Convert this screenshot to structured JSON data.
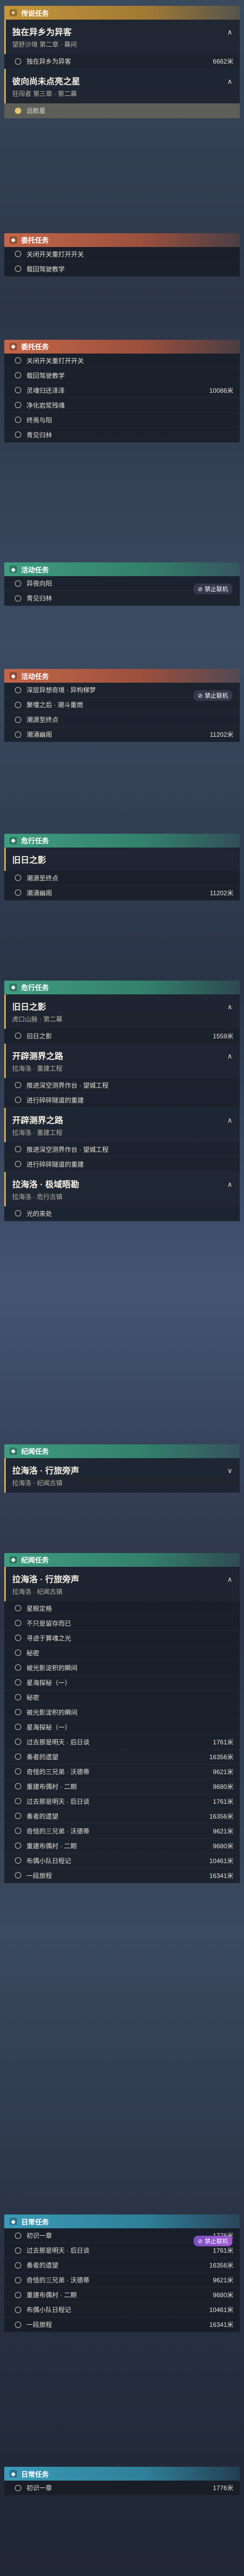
{
  "texts": {
    "legend_quest": "传说任务",
    "world_quest": "委托任务",
    "event_quest": "活动任务",
    "daily_quest": "日常任务",
    "danger_quest": "危行任务",
    "record_quest": "纪闻任务"
  },
  "badges": {
    "disable": "禁止联机",
    "stop": "禁止联机"
  },
  "sections": [
    {
      "type": "legend",
      "header": "传说任务",
      "cards": [
        {
          "title": "独在异乡为异客",
          "sub": "望舒沙境 第二章 · 幕间",
          "arrow": "∧",
          "steps": [
            {
              "t": "独在异乡为异客",
              "d": "6662米"
            }
          ]
        },
        {
          "title": "彼向尚未点亮之星",
          "sub": "狂闯者 第三章 · 第二幕",
          "arrow": "∧",
          "steps": [
            {
              "t": "远航星",
              "d": "",
              "active": true
            }
          ]
        }
      ]
    },
    {
      "type": "world",
      "header": "委托任务",
      "steps": [
        {
          "t": "关闭开关重打开开关",
          "d": ""
        },
        {
          "t": "载回驾驶教学",
          "d": ""
        }
      ]
    },
    {
      "type": "world",
      "header": "委托任务",
      "steps": [
        {
          "t": "关闭开关重打开开关",
          "d": ""
        },
        {
          "t": "载回驾驶教学",
          "d": ""
        },
        {
          "t": "灵魂归还泽泽",
          "d": "10086米"
        },
        {
          "t": "净化岩浆残魂",
          "d": ""
        },
        {
          "t": "终焉与阳",
          "d": ""
        },
        {
          "t": "青见归林",
          "d": ""
        }
      ]
    },
    {
      "type": "event",
      "header": "活动任务",
      "badge": "禁止联机",
      "steps": [
        {
          "t": "异夜向阳",
          "d": ""
        },
        {
          "t": "青见归林",
          "d": ""
        }
      ]
    },
    {
      "type": "world",
      "header": "活动任务",
      "badge": "禁止联机",
      "steps": [
        {
          "t": "深层异想奇境 · 异构梯梦",
          "d": ""
        },
        {
          "t": "聚嚏之后 · 潮斗重燃",
          "d": ""
        },
        {
          "t": "潮源至终点",
          "d": ""
        },
        {
          "t": "潮涌幽阁",
          "d": "11202米"
        }
      ]
    },
    {
      "type": "event",
      "header": "危行任务",
      "cards": [
        {
          "title": "旧日之影",
          "sub": "",
          "arrow": "",
          "steps": [
            {
              "t": "潮源至终点",
              "d": ""
            },
            {
              "t": "潮涌幽阁",
              "d": "11202米"
            }
          ]
        }
      ]
    },
    {
      "type": "event",
      "header": "危行任务",
      "cards": [
        {
          "title": "旧日之影",
          "sub": "虎口山脉 · 第二幕",
          "arrow": "∧",
          "steps": [
            {
              "t": "旧日之影",
              "d": "1559米"
            }
          ]
        },
        {
          "title": "开辟测界之路",
          "sub": "拉海洛 · 重建工程",
          "arrow": "∧",
          "steps": [
            {
              "t": "推进深空测界作台 · 望城工程",
              "d": ""
            },
            {
              "t": "进行碎碎隧道的重建",
              "d": ""
            }
          ]
        },
        {
          "title": "开辟测界之路",
          "sub": "拉海洛 · 重建工程",
          "arrow": "∧",
          "steps": [
            {
              "t": "推进深空测界作台 · 望城工程",
              "d": ""
            },
            {
              "t": "进行碎碎隧道的重建",
              "d": ""
            }
          ]
        },
        {
          "title": "拉海洛 · 极域晤勘",
          "sub": "拉海洛 · 危行古镇",
          "arrow": "∧",
          "steps": [
            {
              "t": "光的来处",
              "d": ""
            }
          ]
        }
      ]
    },
    {
      "type": "event",
      "header": "纪闻任务",
      "cards": [
        {
          "title": "拉海洛 · 行旅旁声",
          "sub": "拉海洛 · 纪闻古镇",
          "arrow": "∨",
          "steps": []
        }
      ]
    },
    {
      "type": "event",
      "header": "纪闻任务",
      "cards": [
        {
          "title": "拉海洛 · 行旅旁声",
          "sub": "拉海洛 · 纪闻古镇",
          "arrow": "∧",
          "steps": [
            {
              "t": "星眼定格",
              "d": ""
            },
            {
              "t": "不只是留存而已",
              "d": ""
            },
            {
              "t": "寻迹于算魂之光",
              "d": ""
            },
            {
              "t": "秘密",
              "d": ""
            },
            {
              "t": "被光影淀积的瞬间",
              "d": ""
            },
            {
              "t": "星海探秘（一）",
              "d": ""
            },
            {
              "t": "秘密",
              "d": ""
            },
            {
              "t": "被光影淀积的瞬间",
              "d": ""
            },
            {
              "t": "星海探秘（一）",
              "d": ""
            },
            {
              "t": "过去那是明天 · 后日谈",
              "d": "1761米"
            },
            {
              "t": "奏者的遗望",
              "d": "16356米"
            },
            {
              "t": "奇怪的三兄弟 · 沃德蒂",
              "d": "9621米"
            },
            {
              "t": "重建布偶村 · 二期",
              "d": "9680米"
            },
            {
              "t": "过去那是明天 · 后日谈",
              "d": "1761米"
            },
            {
              "t": "奏者的遗望",
              "d": "16356米"
            },
            {
              "t": "奇怪的三兄弟 · 沃德蒂",
              "d": "9621米"
            },
            {
              "t": "重建布偶村 · 二期",
              "d": "9680米"
            },
            {
              "t": "布偶小队日程记",
              "d": "10461米"
            },
            {
              "t": "一段旅程",
              "d": "16341米"
            }
          ]
        }
      ]
    },
    {
      "type": "daily",
      "header": "日常任务",
      "badge": "禁止联机",
      "steps": [
        {
          "t": "初识一章",
          "d": "1776米"
        },
        {
          "t": "过去那是明天 · 后日谈",
          "d": "1761米"
        },
        {
          "t": "奏者的遗望",
          "d": "16356米"
        },
        {
          "t": "奇怪的三兄弟 · 沃德蒂",
          "d": "9621米"
        },
        {
          "t": "重建布偶村 · 二期",
          "d": "9680米"
        },
        {
          "t": "布偶小队日程记",
          "d": "10461米"
        },
        {
          "t": "一段旅程",
          "d": "16341米"
        }
      ]
    },
    {
      "type": "daily",
      "header": "日常任务",
      "steps": [
        {
          "t": "初识一章",
          "d": "1776米"
        }
      ]
    }
  ]
}
